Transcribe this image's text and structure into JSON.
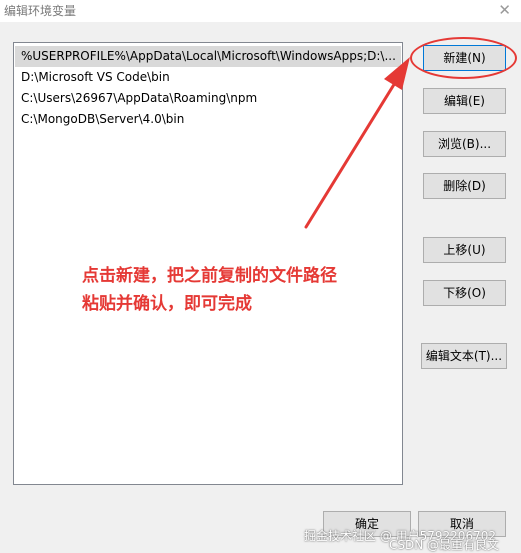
{
  "window": {
    "title": "编辑环境变量"
  },
  "path_list": [
    {
      "label": "%USERPROFILE%\\AppData\\Local\\Microsoft\\WindowsApps;D:\\..."
    },
    {
      "label": "D:\\Microsoft VS Code\\bin"
    },
    {
      "label": "C:\\Users\\26967\\AppData\\Roaming\\npm"
    },
    {
      "label": "C:\\MongoDB\\Server\\4.0\\bin"
    }
  ],
  "buttons": {
    "new": "新建(N)",
    "edit": "编辑(E)",
    "browse": "浏览(B)...",
    "delete": "删除(D)",
    "move_up": "上移(U)",
    "move_down": "下移(O)",
    "edit_text": "编辑文本(T)...",
    "ok": "确定",
    "cancel": "取消"
  },
  "annotation": {
    "line1": "点击新建，把之前复制的文件路径",
    "line2": "粘贴并确认，即可完成"
  },
  "watermark": {
    "line1": "掘金技术社区 @ 用户5792206702",
    "line2": "CSDN @最重有良文"
  },
  "colors": {
    "annotation": "#e53935",
    "selected_row": "#d9d9d9",
    "primary_border": "#0078d7"
  }
}
